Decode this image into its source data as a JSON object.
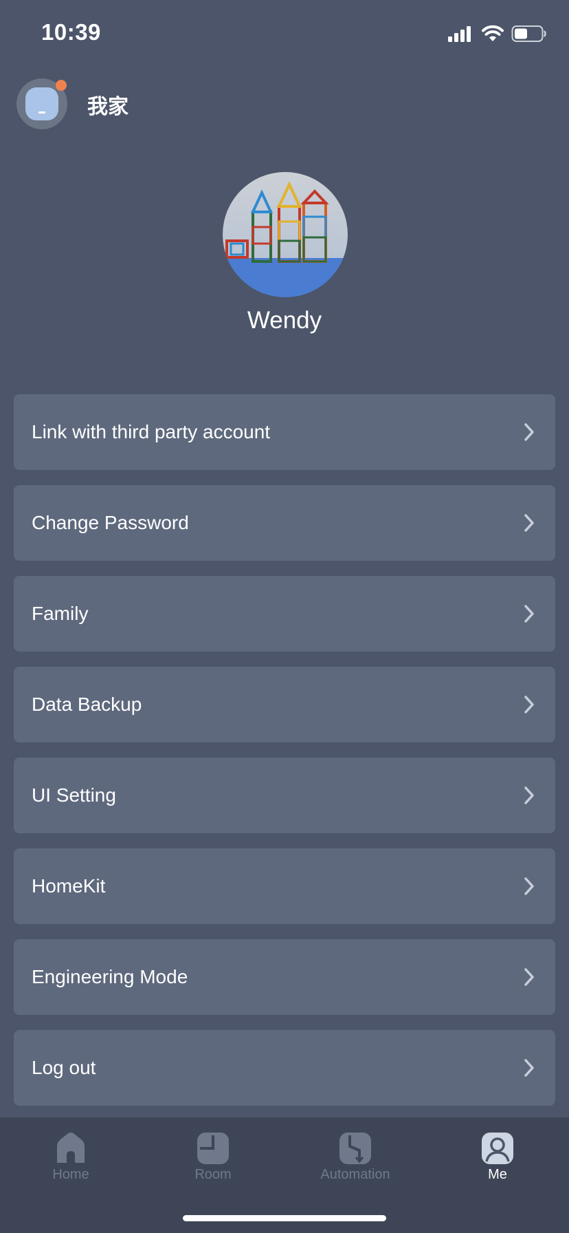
{
  "status_bar": {
    "time": "10:39",
    "icons": [
      "signal-icon",
      "wifi-icon",
      "battery-icon"
    ]
  },
  "header": {
    "home_name": "我家",
    "notification_dot_color": "#f0834d"
  },
  "profile": {
    "name": "Wendy",
    "avatar_alt": "profile-photo"
  },
  "menu": {
    "items": [
      {
        "label": "Link with third party account"
      },
      {
        "label": "Change Password"
      },
      {
        "label": "Family"
      },
      {
        "label": "Data Backup"
      },
      {
        "label": "UI Setting"
      },
      {
        "label": "HomeKit"
      },
      {
        "label": "Engineering Mode"
      },
      {
        "label": "Log out"
      }
    ]
  },
  "tab_bar": {
    "tabs": [
      {
        "label": "Home",
        "icon": "home-icon",
        "active": false
      },
      {
        "label": "Room",
        "icon": "room-icon",
        "active": false
      },
      {
        "label": "Automation",
        "icon": "automation-icon",
        "active": false
      },
      {
        "label": "Me",
        "icon": "person-icon",
        "active": true
      }
    ]
  },
  "colors": {
    "background": "#4c5569",
    "card": "#5e697d",
    "tab_bar": "#3e4556",
    "tab_inactive": "#6f798b",
    "tab_active": "#ffffff"
  }
}
